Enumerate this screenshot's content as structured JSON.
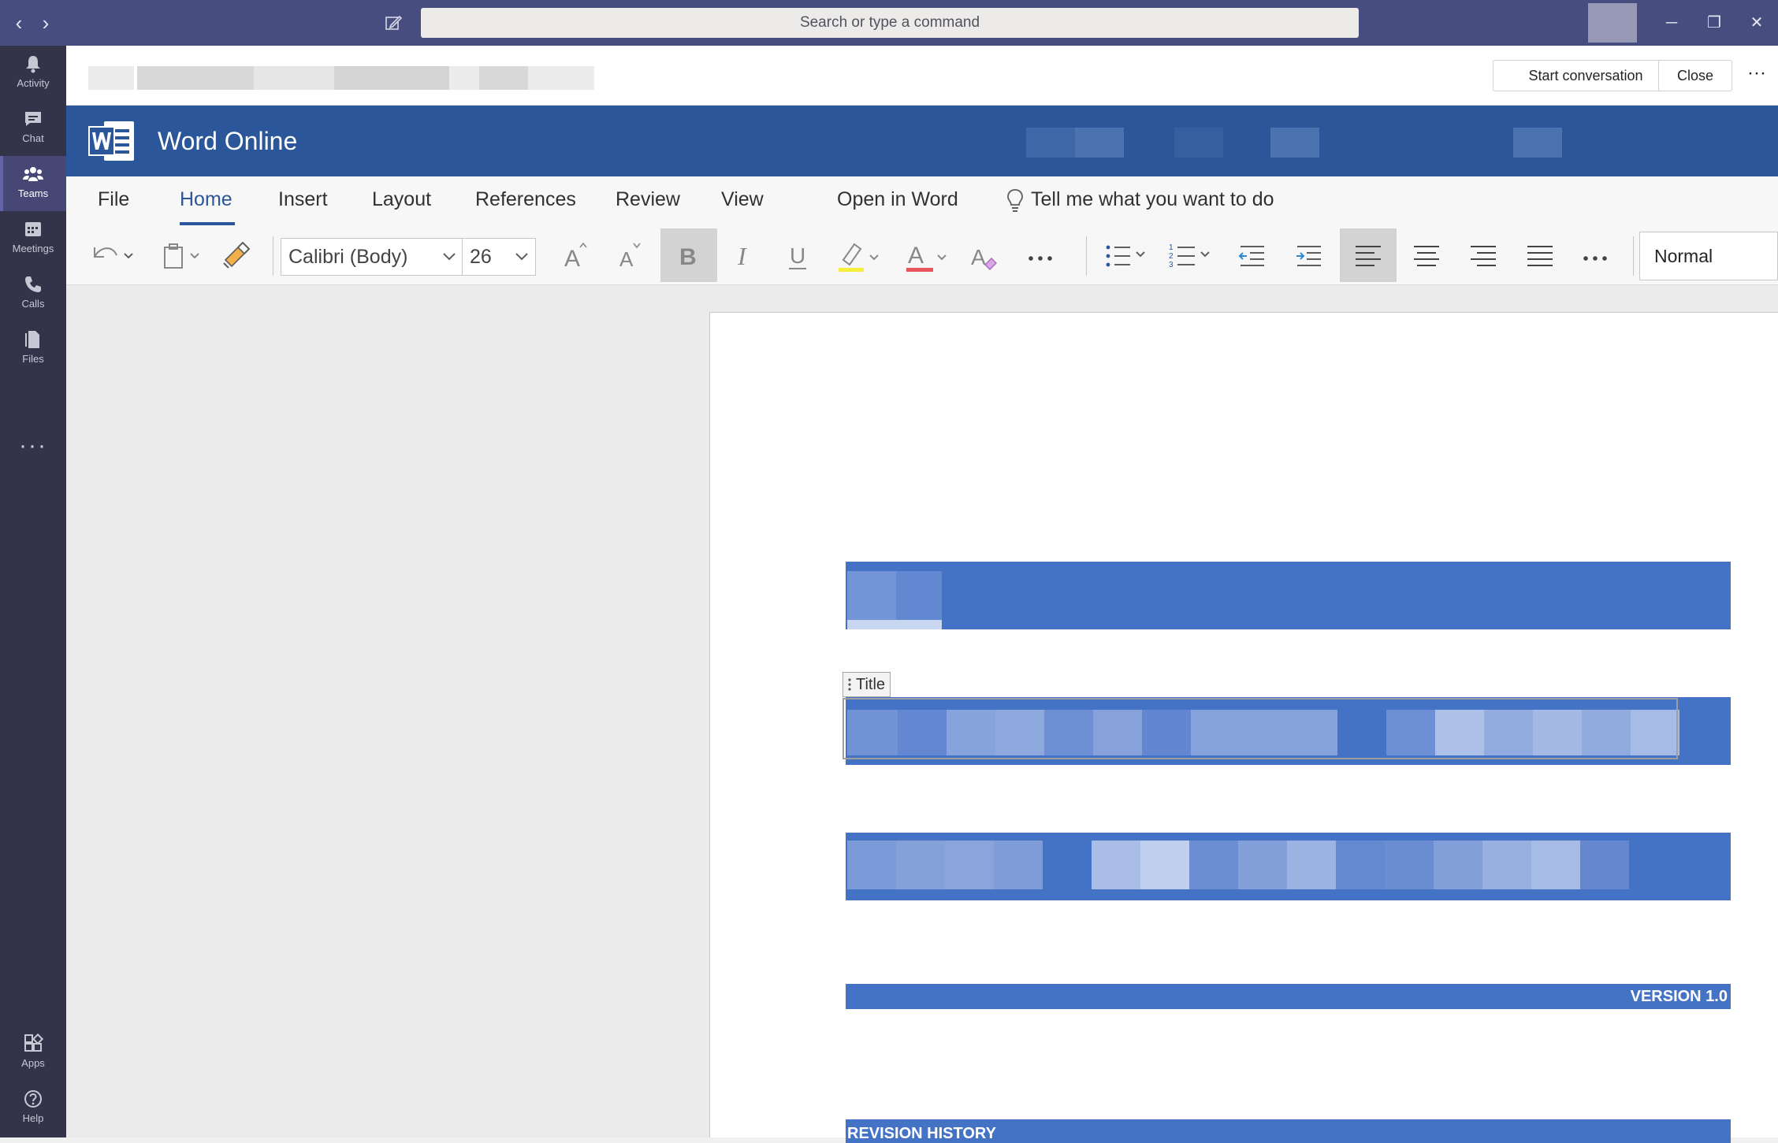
{
  "titlebar": {
    "search_placeholder": "Search or type a command",
    "back_icon": "chevron-left-icon",
    "forward_icon": "chevron-right-icon",
    "compose_icon": "compose-icon",
    "minimize_glyph": "─",
    "restore_glyph": "❐",
    "close_glyph": "✕"
  },
  "rail": {
    "items": [
      {
        "label": "Activity",
        "icon": "bell-icon"
      },
      {
        "label": "Chat",
        "icon": "chat-icon"
      },
      {
        "label": "Teams",
        "icon": "teams-icon",
        "active": true
      },
      {
        "label": "Meetings",
        "icon": "calendar-icon"
      },
      {
        "label": "Calls",
        "icon": "phone-icon"
      },
      {
        "label": "Files",
        "icon": "file-icon"
      }
    ],
    "more": "···",
    "bottom": [
      {
        "label": "Apps",
        "icon": "apps-icon"
      },
      {
        "label": "Help",
        "icon": "help-icon"
      }
    ]
  },
  "header": {
    "start_conversation": "Start conversation",
    "close": "Close",
    "more": "···"
  },
  "word": {
    "app_title": "Word Online",
    "brand_color": "#2b579a"
  },
  "ribbon": {
    "tabs": [
      {
        "label": "File"
      },
      {
        "label": "Home",
        "active": true
      },
      {
        "label": "Insert"
      },
      {
        "label": "Layout"
      },
      {
        "label": "References"
      },
      {
        "label": "Review"
      },
      {
        "label": "View"
      },
      {
        "label": "Open in Word"
      }
    ],
    "tell_me": "Tell me what you want to do",
    "font_name": "Calibri (Body)",
    "font_size": "26",
    "style": "Normal",
    "more_glyph": "···"
  },
  "document": {
    "title_tag": "Title",
    "version": "VERSION 1.0",
    "revision_heading": "REVISION HISTORY",
    "band_color": "#4472c4"
  }
}
